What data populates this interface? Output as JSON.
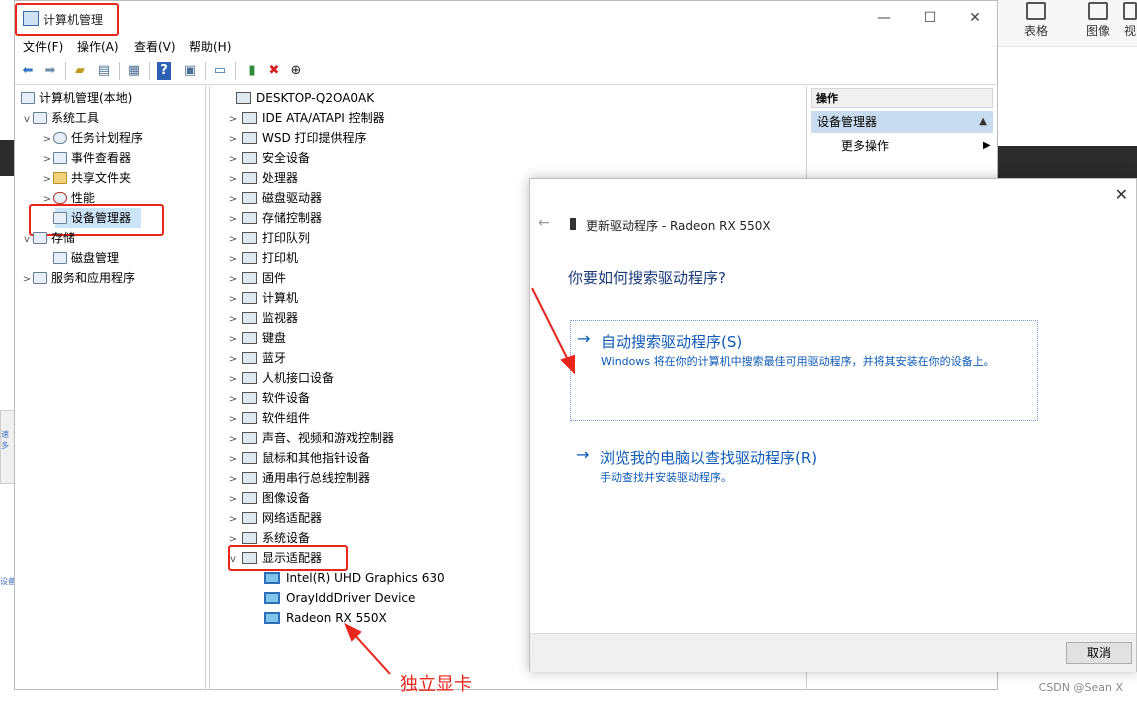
{
  "window": {
    "title": "计算机管理",
    "controls": {
      "minimize": "—",
      "maximize": "☐",
      "close": "✕"
    }
  },
  "menubar": {
    "items": [
      "文件(F)",
      "操作(A)",
      "查看(V)",
      "帮助(H)"
    ]
  },
  "toolbar": {
    "icons": [
      "back-icon",
      "forward-icon",
      "up-folder-icon",
      "show-tree-icon",
      "properties-icon",
      "help-icon",
      "console-icon",
      "monitor-icon",
      "update-driver-icon",
      "uninstall-icon",
      "download-icon"
    ]
  },
  "left_tree": {
    "items": [
      {
        "label": "计算机管理(本地)",
        "level": 0,
        "expander": ""
      },
      {
        "label": "系统工具",
        "level": 1,
        "expander": "v"
      },
      {
        "label": "任务计划程序",
        "level": 2,
        "expander": ">"
      },
      {
        "label": "事件查看器",
        "level": 2,
        "expander": ">"
      },
      {
        "label": "共享文件夹",
        "level": 2,
        "expander": ">"
      },
      {
        "label": "性能",
        "level": 2,
        "expander": ">"
      },
      {
        "label": "设备管理器",
        "level": 2,
        "expander": "",
        "selected": true
      },
      {
        "label": "存储",
        "level": 1,
        "expander": "v"
      },
      {
        "label": "磁盘管理",
        "level": 2,
        "expander": ""
      },
      {
        "label": "服务和应用程序",
        "level": 1,
        "expander": ">"
      }
    ]
  },
  "device_tree": {
    "root": "DESKTOP-Q2OA0AK",
    "categories": [
      "IDE ATA/ATAPI 控制器",
      "WSD 打印提供程序",
      "安全设备",
      "处理器",
      "磁盘驱动器",
      "存储控制器",
      "打印队列",
      "打印机",
      "固件",
      "计算机",
      "监视器",
      "键盘",
      "蓝牙",
      "人机接口设备",
      "软件设备",
      "软件组件",
      "声音、视频和游戏控制器",
      "鼠标和其他指针设备",
      "通用串行总线控制器",
      "图像设备",
      "网络适配器",
      "系统设备",
      "显示适配器"
    ],
    "expanded_category": "显示适配器",
    "display_adapters": [
      "Intel(R) UHD Graphics 630",
      "OrayIddDriver Device",
      "Radeon RX 550X"
    ]
  },
  "actions": {
    "header": "操作",
    "section": "设备管理器",
    "more": "更多操作"
  },
  "dialog": {
    "title": "更新驱动程序 - Radeon RX 550X",
    "question": "你要如何搜索驱动程序?",
    "option_auto": {
      "title": "自动搜索驱动程序(S)",
      "desc": "Windows 将在你的计算机中搜索最佳可用驱动程序，并将其安装在你的设备上。"
    },
    "option_browse": {
      "title": "浏览我的电脑以查找驱动程序(R)",
      "desc": "手动查找并安装驱动程序。"
    },
    "cancel_label": "取消"
  },
  "annotation": {
    "label": "独立显卡"
  },
  "background": {
    "toolbar_items": [
      "表格",
      "图像",
      "视"
    ],
    "left_snippets": [
      "速",
      "多",
      "设备"
    ],
    "watermark": "CSDN @Sean X"
  },
  "colors": {
    "highlight_red": "#e8261c",
    "link_blue": "#0e5ab8",
    "selection": "#cce4f7"
  }
}
